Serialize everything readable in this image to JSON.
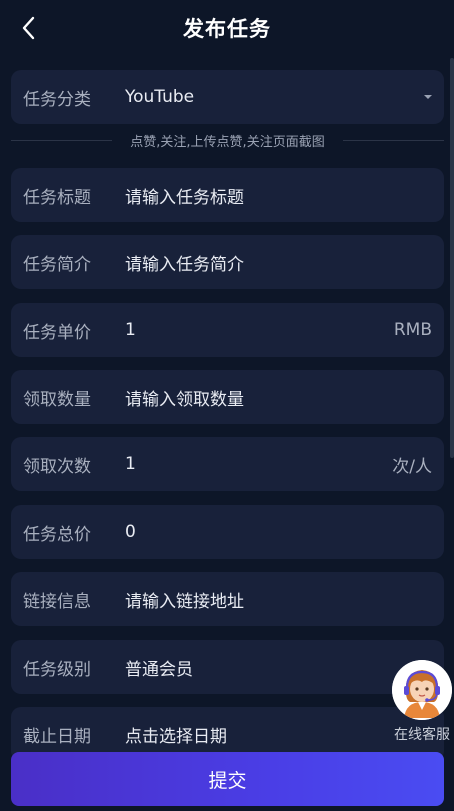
{
  "header": {
    "title": "发布任务"
  },
  "category": {
    "label": "任务分类",
    "value": "YouTube"
  },
  "hint": "点赞,关注,上传点赞,关注页面截图",
  "form": {
    "task_title": {
      "label": "任务标题",
      "placeholder": "请输入任务标题"
    },
    "task_intro": {
      "label": "任务简介",
      "placeholder": "请输入任务简介"
    },
    "unit_price": {
      "label": "任务单价",
      "value": "1",
      "suffix": "RMB"
    },
    "claim_count": {
      "label": "领取数量",
      "placeholder": "请输入领取数量"
    },
    "claim_times": {
      "label": "领取次数",
      "value": "1",
      "suffix": "次/人"
    },
    "total_price": {
      "label": "任务总价",
      "value": "0"
    },
    "link": {
      "label": "链接信息",
      "placeholder": "请输入链接地址"
    },
    "level": {
      "label": "任务级别",
      "value": "普通会员"
    },
    "deadline": {
      "label": "截止日期",
      "placeholder": "点击选择日期"
    }
  },
  "customer_service": {
    "label": "在线客服",
    "icon": "customer-service-agent-icon"
  },
  "submit": {
    "label": "提交"
  },
  "colors": {
    "background": "#0d1628",
    "row": "#18213a",
    "submit_start": "#4a2fc7",
    "submit_end": "#4a4cf2"
  }
}
